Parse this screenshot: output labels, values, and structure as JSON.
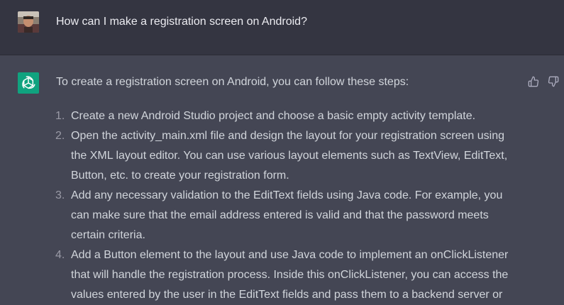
{
  "user_message": {
    "text": "How can I make a registration screen on Android?",
    "avatar": "user-photo"
  },
  "assistant_message": {
    "avatar": "openai-logo-icon",
    "avatar_color": "#10a37f",
    "intro": "To create a registration screen on Android, you can follow these steps:",
    "steps": [
      {
        "number": "1.",
        "lines": [
          "Create a new Android Studio project and choose a basic empty activity template."
        ]
      },
      {
        "number": "2.",
        "lines": [
          "Open the activity_main.xml file and design the layout for your registration screen using",
          "the XML layout editor. You can use various layout elements such as TextView, EditText,",
          "Button, etc. to create your registration form."
        ]
      },
      {
        "number": "3.",
        "lines": [
          "Add any necessary validation to the EditText fields using Java code. For example, you",
          "can make sure that the email address entered is valid and that the password meets",
          "certain criteria."
        ]
      },
      {
        "number": "4.",
        "lines": [
          "Add a Button element to the layout and use Java code to implement an onClickListener",
          "that will handle the registration process. Inside this onClickListener, you can access the",
          "values entered by the user in the EditText fields and pass them to a backend server or"
        ]
      }
    ],
    "feedback": {
      "thumbs_up_icon": "thumbs-up-icon",
      "thumbs_down_icon": "thumbs-down-icon"
    }
  },
  "colors": {
    "user_bg": "#343541",
    "assistant_bg": "#444654",
    "text": "#d1d5db",
    "accent": "#10a37f"
  }
}
